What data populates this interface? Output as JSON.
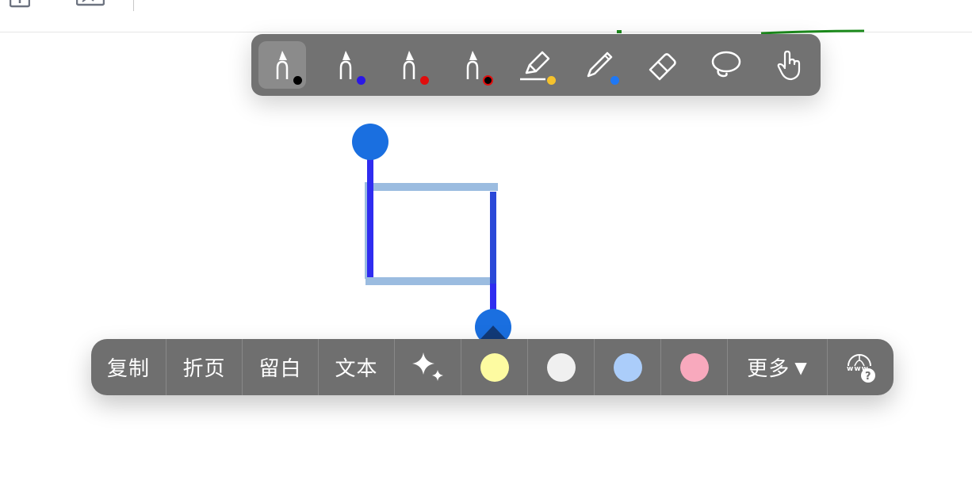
{
  "pen_toolbar": {
    "tools": [
      {
        "name": "fountain-pen",
        "color": "#000000",
        "selected": true
      },
      {
        "name": "fountain-pen",
        "color": "#2a17e6"
      },
      {
        "name": "fountain-pen",
        "color": "#e00d0d"
      },
      {
        "name": "fountain-pen",
        "color": "#000000",
        "ring": "#e00d0d"
      },
      {
        "name": "highlighter",
        "color": "#f5c22c"
      },
      {
        "name": "pencil",
        "color": "#1f78f5"
      },
      {
        "name": "eraser"
      },
      {
        "name": "lasso"
      },
      {
        "name": "hand"
      }
    ]
  },
  "context_menu": {
    "copy": "复制",
    "fold_page": "折页",
    "margin": "留白",
    "text": "文本",
    "more": "更多",
    "more_arrow": "▼",
    "swatches": [
      "#fdfba1",
      "#f0f0f0",
      "#abcdfa",
      "#f8a9bd"
    ]
  },
  "colors": {
    "selection_handle": "#1a6fe0",
    "shape_stroke": "#2f2cf0",
    "shape_highlight": "#9bbce0"
  }
}
